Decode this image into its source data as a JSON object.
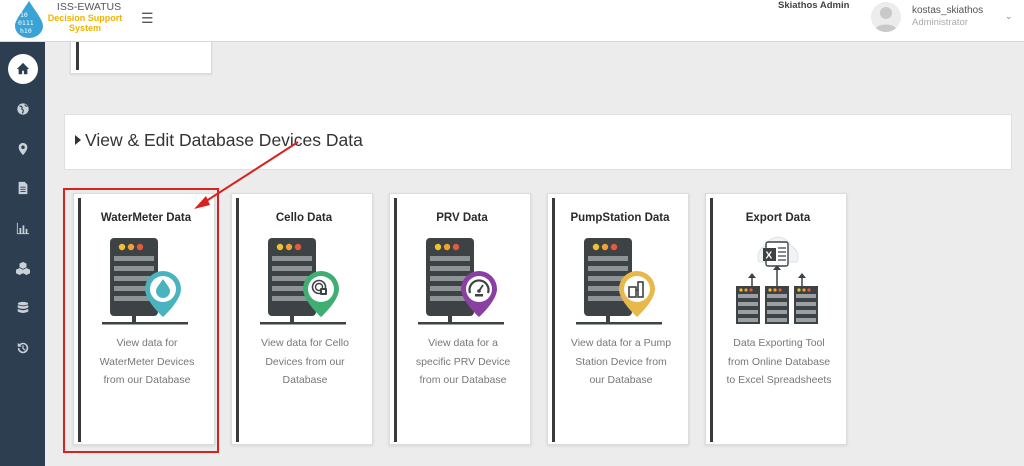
{
  "header": {
    "brand_title": "ISS-EWATUS",
    "brand_subtitle_1": "Decision Support",
    "brand_subtitle_2": "System",
    "menu_icon": "hamburger-icon",
    "site_name": "Skiathos Admin",
    "user_name": "kostas_skiathos",
    "user_role": "Administrator"
  },
  "sidebar": {
    "items": [
      {
        "icon": "home-icon",
        "active": true
      },
      {
        "icon": "globe-icon"
      },
      {
        "icon": "map-marker-icon"
      },
      {
        "icon": "document-icon"
      },
      {
        "icon": "bar-chart-icon"
      },
      {
        "icon": "cubes-icon"
      },
      {
        "icon": "database-icon"
      },
      {
        "icon": "history-icon"
      }
    ]
  },
  "section": {
    "title": "View & Edit Database Devices Data"
  },
  "cards": [
    {
      "title": "WaterMeter Data",
      "desc_1": "View data for",
      "desc_2": "WaterMeter Devices",
      "desc_3": "from our Database",
      "icon": "water-drop-icon",
      "color": "#4bb3c0"
    },
    {
      "title": "Cello Data",
      "desc_1": "View data for Cello",
      "desc_2": "Devices from our",
      "desc_3": "Database",
      "icon": "cello-device-icon",
      "color": "#3fae73"
    },
    {
      "title": "PRV Data",
      "desc_1": "View data for a",
      "desc_2": "specific PRV Device",
      "desc_3": "from our Database",
      "icon": "pressure-gauge-icon",
      "color": "#8a3fa3"
    },
    {
      "title": "PumpStation Data",
      "desc_1": "View data for a Pump",
      "desc_2": "Station Device from",
      "desc_3": "our Database",
      "icon": "pump-station-icon",
      "color": "#e9b84a"
    },
    {
      "title": "Export Data",
      "desc_1": "Data Exporting Tool",
      "desc_2": "from Online Database",
      "desc_3": "to Excel Spreadsheets",
      "icon": "excel-export-icon",
      "color": "#1e7145"
    }
  ],
  "annotation": {
    "highlight_color": "#d7221f"
  }
}
